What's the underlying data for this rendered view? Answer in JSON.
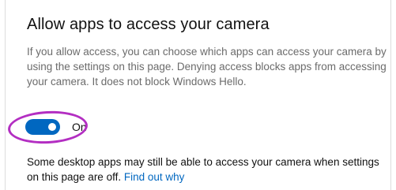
{
  "section": {
    "title": "Allow apps to access your camera",
    "description": "If you allow access, you can choose which apps can access your camera by using the settings on this page. Denying access blocks apps from accessing your camera. It does not block Windows Hello."
  },
  "toggle": {
    "state": "on",
    "label": "On",
    "color": "#0067c0"
  },
  "annotation": {
    "color": "#b32ec2"
  },
  "note": {
    "text": "Some desktop apps may still be able to access your camera when settings on this page are off.",
    "link_text": "Find out why",
    "link_color": "#0067c0"
  }
}
